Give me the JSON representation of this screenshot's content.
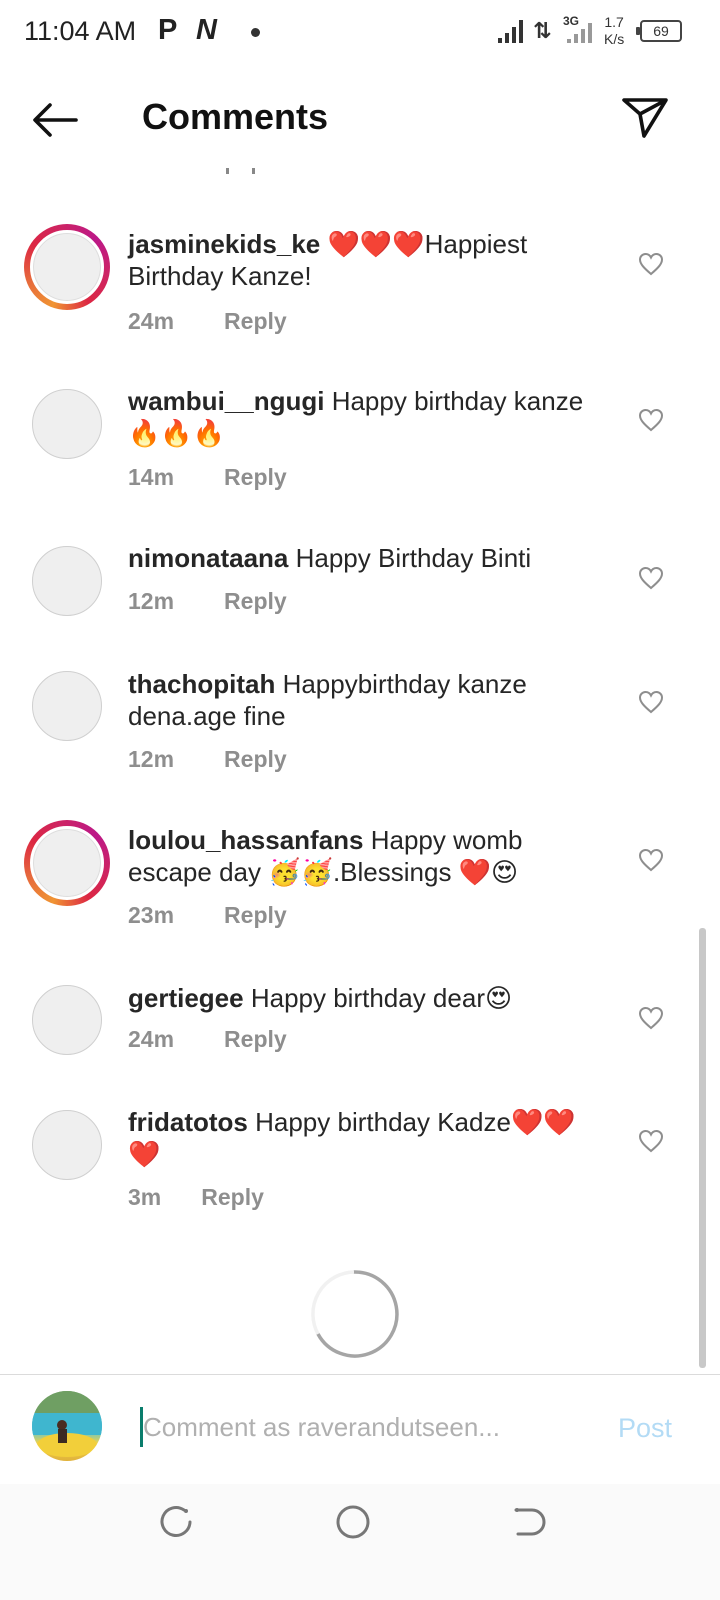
{
  "status_bar": {
    "time": "11:04 AM",
    "notif_p": "P",
    "notif_n": "N",
    "network_type": "3G",
    "speed_value": "1.7",
    "speed_unit": "K/s",
    "battery": "69"
  },
  "header": {
    "title": "Comments"
  },
  "comments": [
    {
      "username": "jasminekids_ke",
      "text": " ❤️❤️❤️Happiest Birthday Kanze!",
      "time": "24m",
      "reply": "Reply",
      "story": true
    },
    {
      "username": "wambui__ngugi",
      "text": " Happy birthday kanze 🔥🔥🔥",
      "time": "14m",
      "reply": "Reply",
      "story": false
    },
    {
      "username": "nimonataana",
      "text": " Happy Birthday Binti",
      "time": "12m",
      "reply": "Reply",
      "story": false
    },
    {
      "username": "thachopitah",
      "text": " Happybirthday kanze dena.age fine",
      "time": "12m",
      "reply": "Reply",
      "story": false
    },
    {
      "username": "loulou_hassanfans",
      "text": " Happy womb escape day 🥳🥳.Blessings ❤️😍",
      "time": "23m",
      "reply": "Reply",
      "story": true
    },
    {
      "username": "gertiegee",
      "text": " Happy birthday dear😍",
      "time": "24m",
      "reply": "Reply",
      "story": false
    },
    {
      "username": "fridatotos",
      "text": " Happy birthday Kadze❤️❤️❤️",
      "time": "3m",
      "reply": "Reply",
      "story": false
    }
  ],
  "composer": {
    "placeholder": "Comment as raverandutseen...",
    "post_label": "Post"
  },
  "colors": {
    "post_disabled": "#b3dbf5",
    "meta_gray": "#8e8e8e",
    "caret": "#0a7d6c"
  }
}
